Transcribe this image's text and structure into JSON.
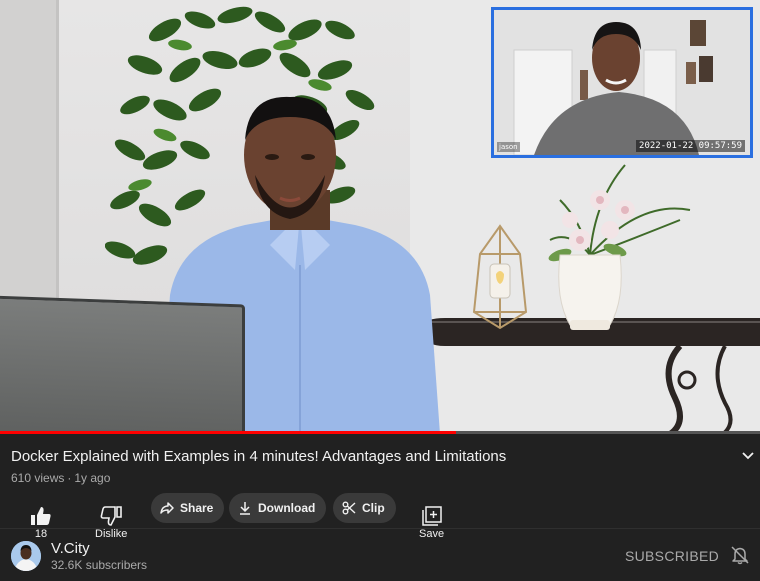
{
  "video": {
    "pip_name": "jason",
    "pip_timestamp": "2022-01-22  09:57:59",
    "progress_fraction": 0.6
  },
  "info": {
    "title": "Docker Explained with Examples in 4 minutes! Advantages and Limitations",
    "views": "610 views",
    "age": "1y ago"
  },
  "actions": {
    "like_count": "18",
    "dislike_label": "Dislike",
    "share_label": "Share",
    "download_label": "Download",
    "clip_label": "Clip",
    "save_label": "Save"
  },
  "channel": {
    "name": "V.City",
    "subscribers": "32.6K subscribers",
    "subscribe_state": "SUBSCRIBED"
  },
  "colors": {
    "background": "#212121",
    "progress": "#ff0000",
    "pip_border": "#2a6fe0",
    "pill": "#3a3a3a",
    "muted_text": "#aaaaaa"
  },
  "icons": [
    "like-icon",
    "dislike-icon",
    "share-icon",
    "download-icon",
    "clip-icon",
    "save-playlist-icon",
    "bell-off-icon",
    "chevron-down-icon"
  ]
}
